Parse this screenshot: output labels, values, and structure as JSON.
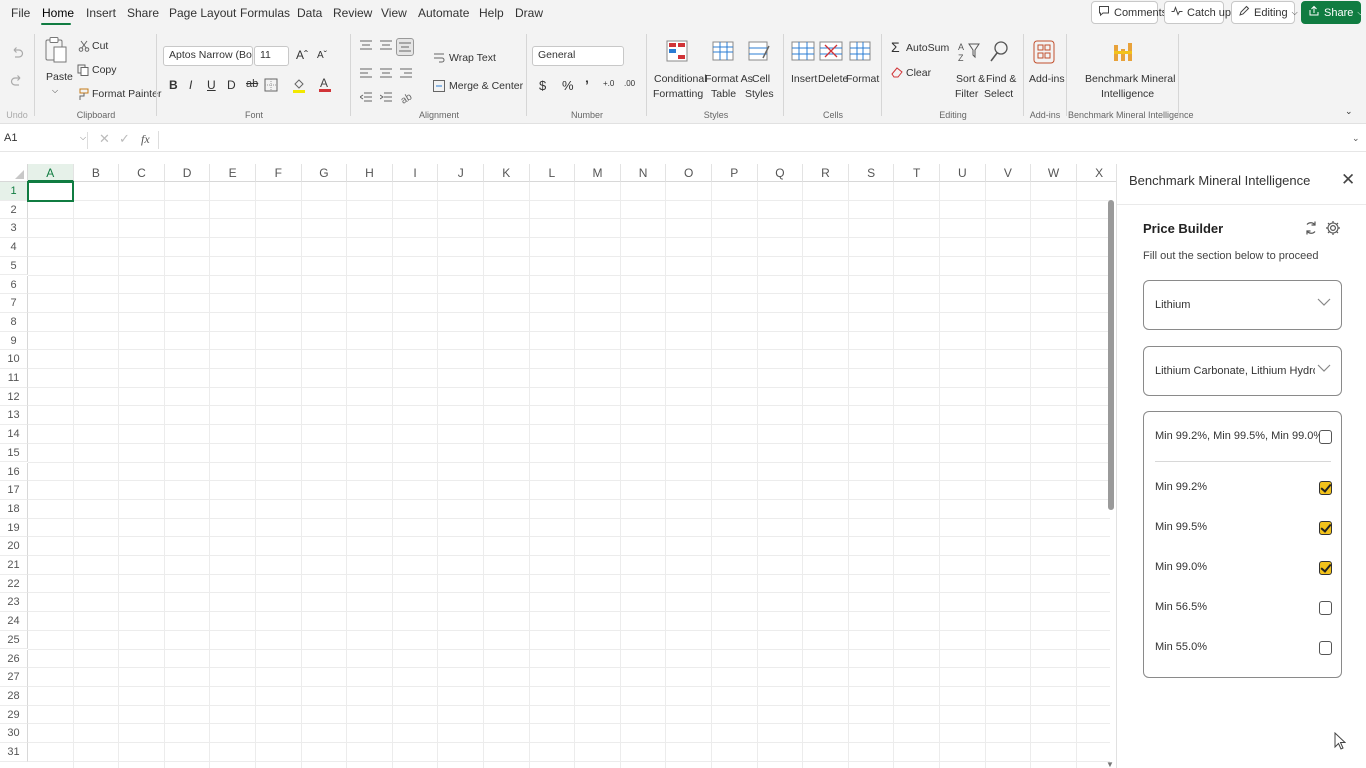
{
  "menubar": {
    "tabs": [
      "File",
      "Home",
      "Insert",
      "Share",
      "Page Layout",
      "Formulas",
      "Data",
      "Review",
      "View",
      "Automate",
      "Help",
      "Draw"
    ],
    "active_tab": "Home",
    "comments_label": "Comments",
    "catchup_label": "Catch up",
    "editing_label": "Editing",
    "share_label": "Share",
    "accent_color": "#107c41"
  },
  "ribbon": {
    "undo": {
      "label": "Undo"
    },
    "clipboard": {
      "paste": "Paste",
      "cut": "Cut",
      "copy": "Copy",
      "format_painter": "Format Painter",
      "label": "Clipboard"
    },
    "font": {
      "name": "Aptos Narrow (Bo...",
      "size": "11",
      "label": "Font"
    },
    "alignment": {
      "wrap_text": "Wrap Text",
      "merge_center": "Merge & Center",
      "label": "Alignment"
    },
    "number": {
      "format": "General",
      "label": "Number"
    },
    "styles": {
      "conditional_1": "Conditional",
      "conditional_2": "Formatting",
      "format_table_1": "Format As",
      "format_table_2": "Table",
      "cell_styles_1": "Cell",
      "cell_styles_2": "Styles",
      "label": "Styles"
    },
    "cells": {
      "insert": "Insert",
      "delete": "Delete",
      "format": "Format",
      "label": "Cells"
    },
    "editing": {
      "autosum": "AutoSum",
      "clear": "Clear",
      "sort_1": "Sort &",
      "sort_2": "Filter",
      "find_1": "Find &",
      "find_2": "Select",
      "label": "Editing"
    },
    "addins": {
      "addins": "Add-ins",
      "label": "Add-ins"
    },
    "bmi": {
      "line1": "Benchmark Mineral",
      "line2": "Intelligence",
      "label": "Benchmark Mineral Intelligence"
    }
  },
  "formula_bar": {
    "name_box": "A1",
    "fx": "fx",
    "value": ""
  },
  "grid": {
    "columns": [
      "A",
      "B",
      "C",
      "D",
      "E",
      "F",
      "G",
      "H",
      "I",
      "J",
      "K",
      "L",
      "M",
      "N",
      "O",
      "P",
      "Q",
      "R",
      "S",
      "T",
      "U",
      "V",
      "W",
      "X"
    ],
    "rows": [
      "1",
      "2",
      "3",
      "4",
      "5",
      "6",
      "7",
      "8",
      "9",
      "10",
      "11",
      "12",
      "13",
      "14",
      "15",
      "16",
      "17",
      "18",
      "19",
      "20",
      "21",
      "22",
      "23",
      "24",
      "25",
      "26",
      "27",
      "28",
      "29",
      "30",
      "31"
    ],
    "active_cell": "A1"
  },
  "pane": {
    "title": "Benchmark Mineral Intelligence",
    "price_builder": {
      "title": "Price Builder",
      "subtitle": "Fill out the section below to proceed",
      "commodity": "Lithium",
      "product": "Lithium Carbonate, Lithium Hydro...",
      "grades_all_label": "Min 99.2%, Min 99.5%, Min 99.0%",
      "grades": [
        {
          "label": "Min 99.2%",
          "checked": true
        },
        {
          "label": "Min 99.5%",
          "checked": true
        },
        {
          "label": "Min 99.0%",
          "checked": true
        },
        {
          "label": "Min 56.5%",
          "checked": false
        },
        {
          "label": "Min 55.0%",
          "checked": false
        }
      ],
      "check_color": "#f2c21b"
    }
  }
}
